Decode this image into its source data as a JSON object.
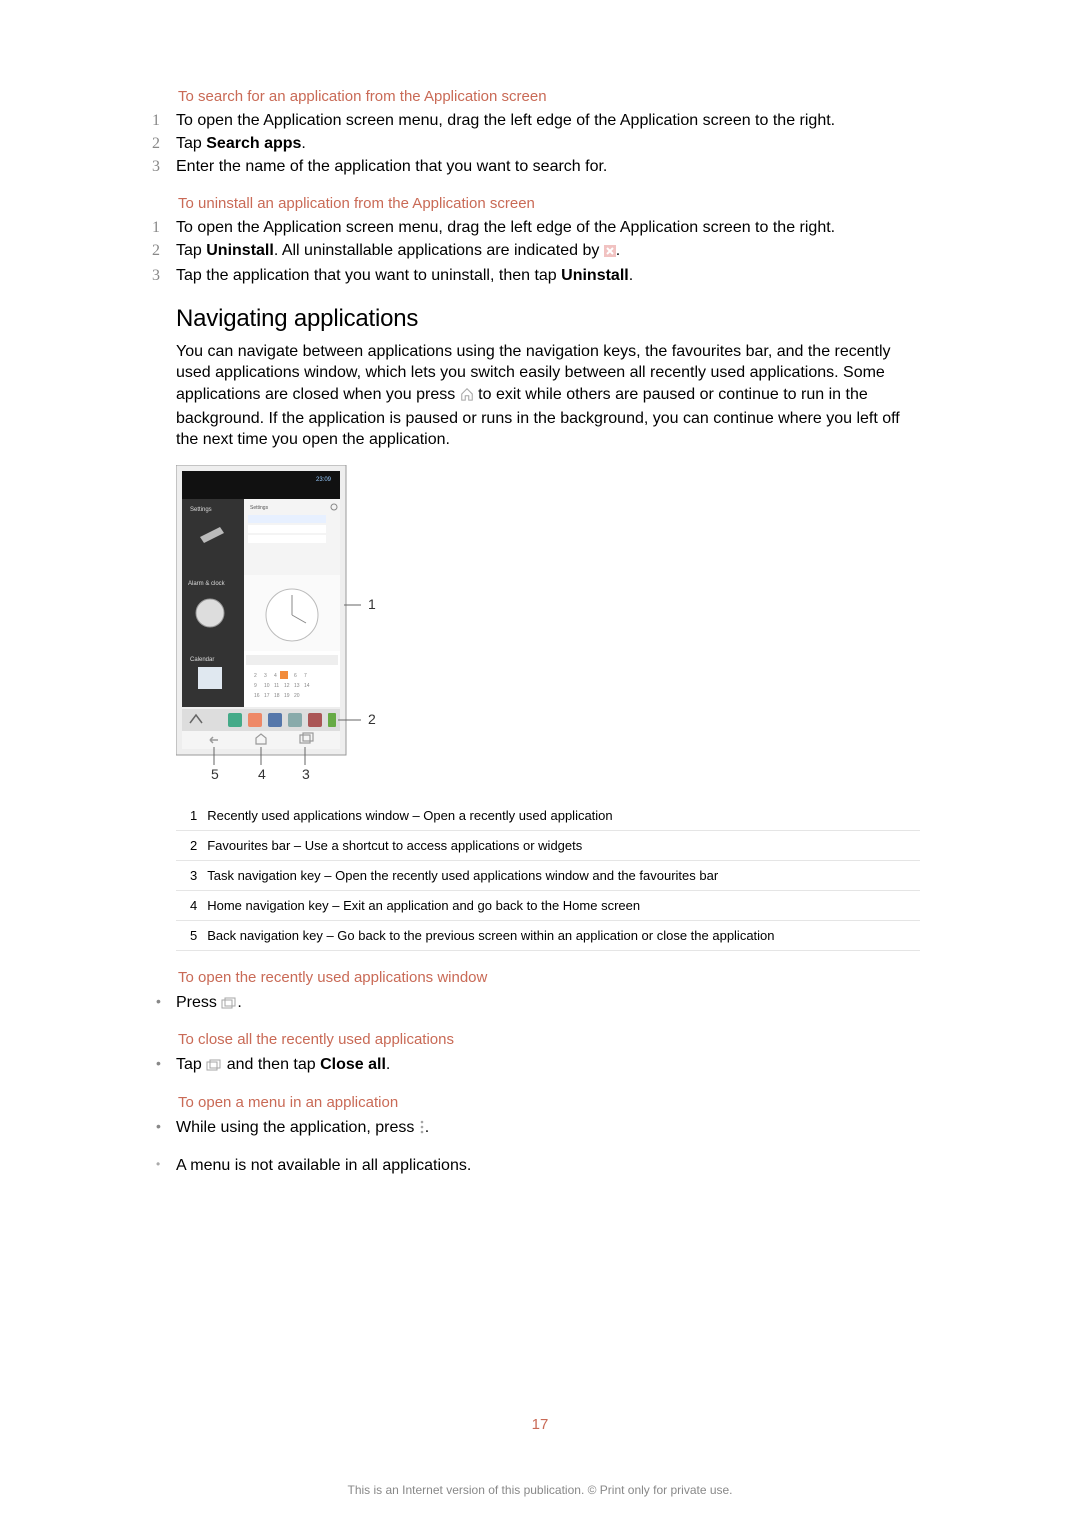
{
  "sections": {
    "search": {
      "title": "To search for an application from the Application screen",
      "steps": {
        "s1": "To open the Application screen menu, drag the left edge of the Application screen to the right.",
        "s2_pre": "Tap ",
        "s2_bold": "Search apps",
        "s2_post": ".",
        "s3": "Enter the name of the application that you want to search for."
      }
    },
    "uninstall": {
      "title": "To uninstall an application from the Application screen",
      "steps": {
        "s1": "To open the Application screen menu, drag the left edge of the Application screen to the right.",
        "s2_pre": "Tap ",
        "s2_bold": "Uninstall",
        "s2_post": ". All uninstallable applications are indicated by ",
        "s2_end": ".",
        "s3_pre": "Tap the application that you want to uninstall, then tap ",
        "s3_bold": "Uninstall",
        "s3_post": "."
      }
    },
    "nav": {
      "heading": "Navigating applications",
      "para_pre": "You can navigate between applications using the navigation keys, the favourites bar, and the recently used applications window, which lets you switch easily between all recently used applications. Some applications are closed when you press ",
      "para_post": " to exit while others are paused or continue to run in the background. If the application is paused or runs in the background, you can continue where you left off the next time you open the application."
    },
    "legend": {
      "1": "Recently used applications window – Open a recently used application",
      "2": "Favourites bar – Use a shortcut to access applications or widgets",
      "3": "Task navigation key – Open the recently used applications window and the favourites bar",
      "4": "Home navigation key – Exit an application and go back to the Home screen",
      "5": "Back navigation key – Go back to the previous screen within an application or close the application"
    },
    "recent_open": {
      "title": "To open the recently used applications window",
      "step_pre": "Press ",
      "step_post": "."
    },
    "recent_close": {
      "title": "To close all the recently used applications",
      "step_pre": "Tap ",
      "step_mid": " and then tap ",
      "step_bold": "Close all",
      "step_post": "."
    },
    "menu_open": {
      "title": "To open a menu in an application",
      "step_pre": "While using the application, press ",
      "step_post": "."
    },
    "note": "A menu is not available in all applications."
  },
  "page_number": "17",
  "disclaimer": "This is an Internet version of this publication. © Print only for private use."
}
